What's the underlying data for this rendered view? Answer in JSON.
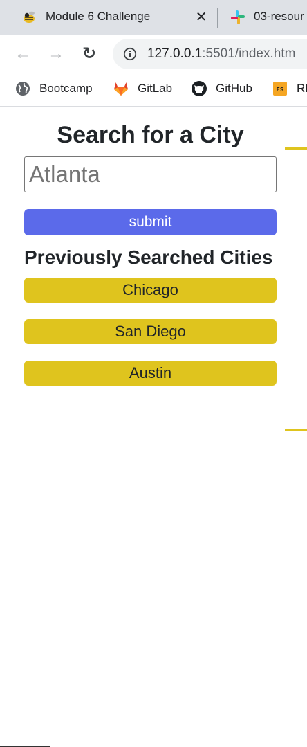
{
  "browser": {
    "tabs": [
      {
        "title": "Module 6 Challenge",
        "icon": "yellow-jacket-icon",
        "close": "✕"
      },
      {
        "title": "03-resour",
        "icon": "slack-icon"
      }
    ],
    "toolbar": {
      "back": "←",
      "forward": "→",
      "reload": "↻"
    },
    "url": {
      "host": "127.0.0.1",
      "path": ":5501/index.htm"
    },
    "bookmarks": [
      {
        "label": "Bootcamp",
        "icon": "globe-icon"
      },
      {
        "label": "GitLab",
        "icon": "gitlab-icon"
      },
      {
        "label": "GitHub",
        "icon": "github-icon"
      },
      {
        "label": "RE",
        "icon": "fs-icon",
        "icon_text": "FS"
      }
    ]
  },
  "page": {
    "title": "Search for a City",
    "search": {
      "placeholder": "Atlanta"
    },
    "submit_label": "submit",
    "previous_heading": "Previously Searched Cities",
    "previous_cities": [
      "Chicago",
      "San Diego",
      "Austin"
    ]
  },
  "colors": {
    "submit": "#5b6aea",
    "city_button": "#dfc41e",
    "tabbar": "#dee1e6"
  }
}
